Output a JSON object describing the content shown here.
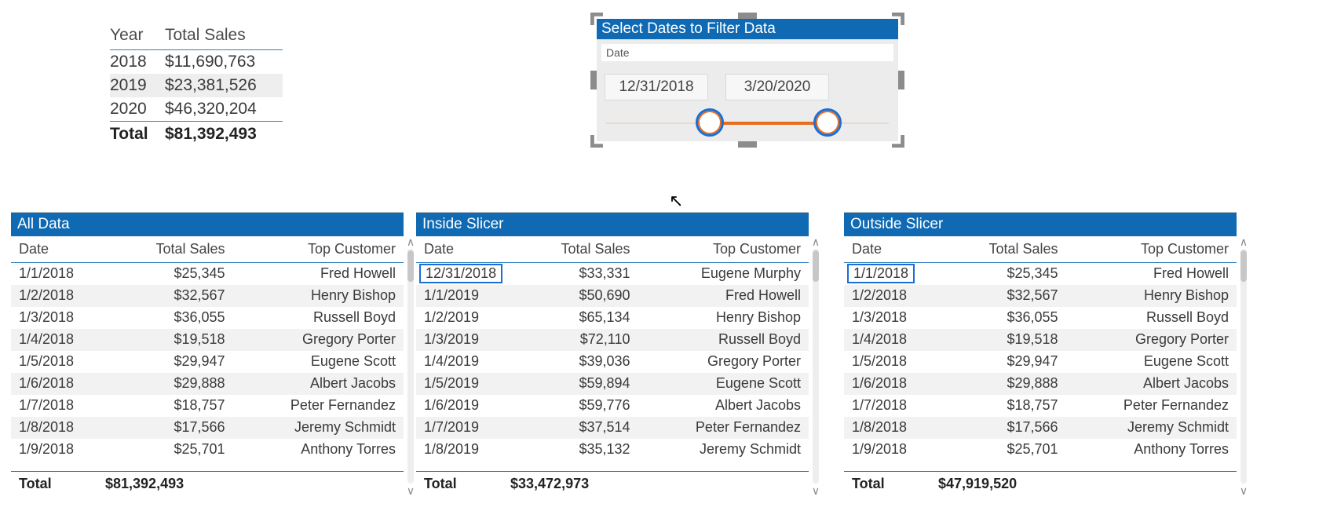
{
  "summary": {
    "headers": [
      "Year",
      "Total Sales"
    ],
    "rows": [
      {
        "year": "2018",
        "sales": "$11,690,763"
      },
      {
        "year": "2019",
        "sales": "$23,381,526"
      },
      {
        "year": "2020",
        "sales": "$46,320,204"
      }
    ],
    "total_label": "Total",
    "total_value": "$81,392,493"
  },
  "slicer": {
    "title": "Select Dates to Filter Data",
    "field_label": "Date",
    "start": "12/31/2018",
    "end": "3/20/2020"
  },
  "tables": [
    {
      "title": "All Data",
      "headers": [
        "Date",
        "Total Sales",
        "Top Customer"
      ],
      "highlight_first": false,
      "rows": [
        {
          "d": "1/1/2018",
          "s": "$25,345",
          "c": "Fred Howell"
        },
        {
          "d": "1/2/2018",
          "s": "$32,567",
          "c": "Henry Bishop"
        },
        {
          "d": "1/3/2018",
          "s": "$36,055",
          "c": "Russell Boyd"
        },
        {
          "d": "1/4/2018",
          "s": "$19,518",
          "c": "Gregory Porter"
        },
        {
          "d": "1/5/2018",
          "s": "$29,947",
          "c": "Eugene Scott"
        },
        {
          "d": "1/6/2018",
          "s": "$29,888",
          "c": "Albert Jacobs"
        },
        {
          "d": "1/7/2018",
          "s": "$18,757",
          "c": "Peter Fernandez"
        },
        {
          "d": "1/8/2018",
          "s": "$17,566",
          "c": "Jeremy Schmidt"
        },
        {
          "d": "1/9/2018",
          "s": "$25,701",
          "c": "Anthony Torres"
        }
      ],
      "total_label": "Total",
      "total_value": "$81,392,493"
    },
    {
      "title": "Inside Slicer",
      "headers": [
        "Date",
        "Total Sales",
        "Top Customer"
      ],
      "highlight_first": true,
      "rows": [
        {
          "d": "12/31/2018",
          "s": "$33,331",
          "c": "Eugene Murphy"
        },
        {
          "d": "1/1/2019",
          "s": "$50,690",
          "c": "Fred Howell"
        },
        {
          "d": "1/2/2019",
          "s": "$65,134",
          "c": "Henry Bishop"
        },
        {
          "d": "1/3/2019",
          "s": "$72,110",
          "c": "Russell Boyd"
        },
        {
          "d": "1/4/2019",
          "s": "$39,036",
          "c": "Gregory Porter"
        },
        {
          "d": "1/5/2019",
          "s": "$59,894",
          "c": "Eugene Scott"
        },
        {
          "d": "1/6/2019",
          "s": "$59,776",
          "c": "Albert Jacobs"
        },
        {
          "d": "1/7/2019",
          "s": "$37,514",
          "c": "Peter Fernandez"
        },
        {
          "d": "1/8/2019",
          "s": "$35,132",
          "c": "Jeremy Schmidt"
        }
      ],
      "total_label": "Total",
      "total_value": "$33,472,973"
    },
    {
      "title": "Outside Slicer",
      "headers": [
        "Date",
        "Total Sales",
        "Top Customer"
      ],
      "highlight_first": true,
      "rows": [
        {
          "d": "1/1/2018",
          "s": "$25,345",
          "c": "Fred Howell"
        },
        {
          "d": "1/2/2018",
          "s": "$32,567",
          "c": "Henry Bishop"
        },
        {
          "d": "1/3/2018",
          "s": "$36,055",
          "c": "Russell Boyd"
        },
        {
          "d": "1/4/2018",
          "s": "$19,518",
          "c": "Gregory Porter"
        },
        {
          "d": "1/5/2018",
          "s": "$29,947",
          "c": "Eugene Scott"
        },
        {
          "d": "1/6/2018",
          "s": "$29,888",
          "c": "Albert Jacobs"
        },
        {
          "d": "1/7/2018",
          "s": "$18,757",
          "c": "Peter Fernandez"
        },
        {
          "d": "1/8/2018",
          "s": "$17,566",
          "c": "Jeremy Schmidt"
        },
        {
          "d": "1/9/2018",
          "s": "$25,701",
          "c": "Anthony Torres"
        }
      ],
      "total_label": "Total",
      "total_value": "$47,919,520"
    }
  ]
}
